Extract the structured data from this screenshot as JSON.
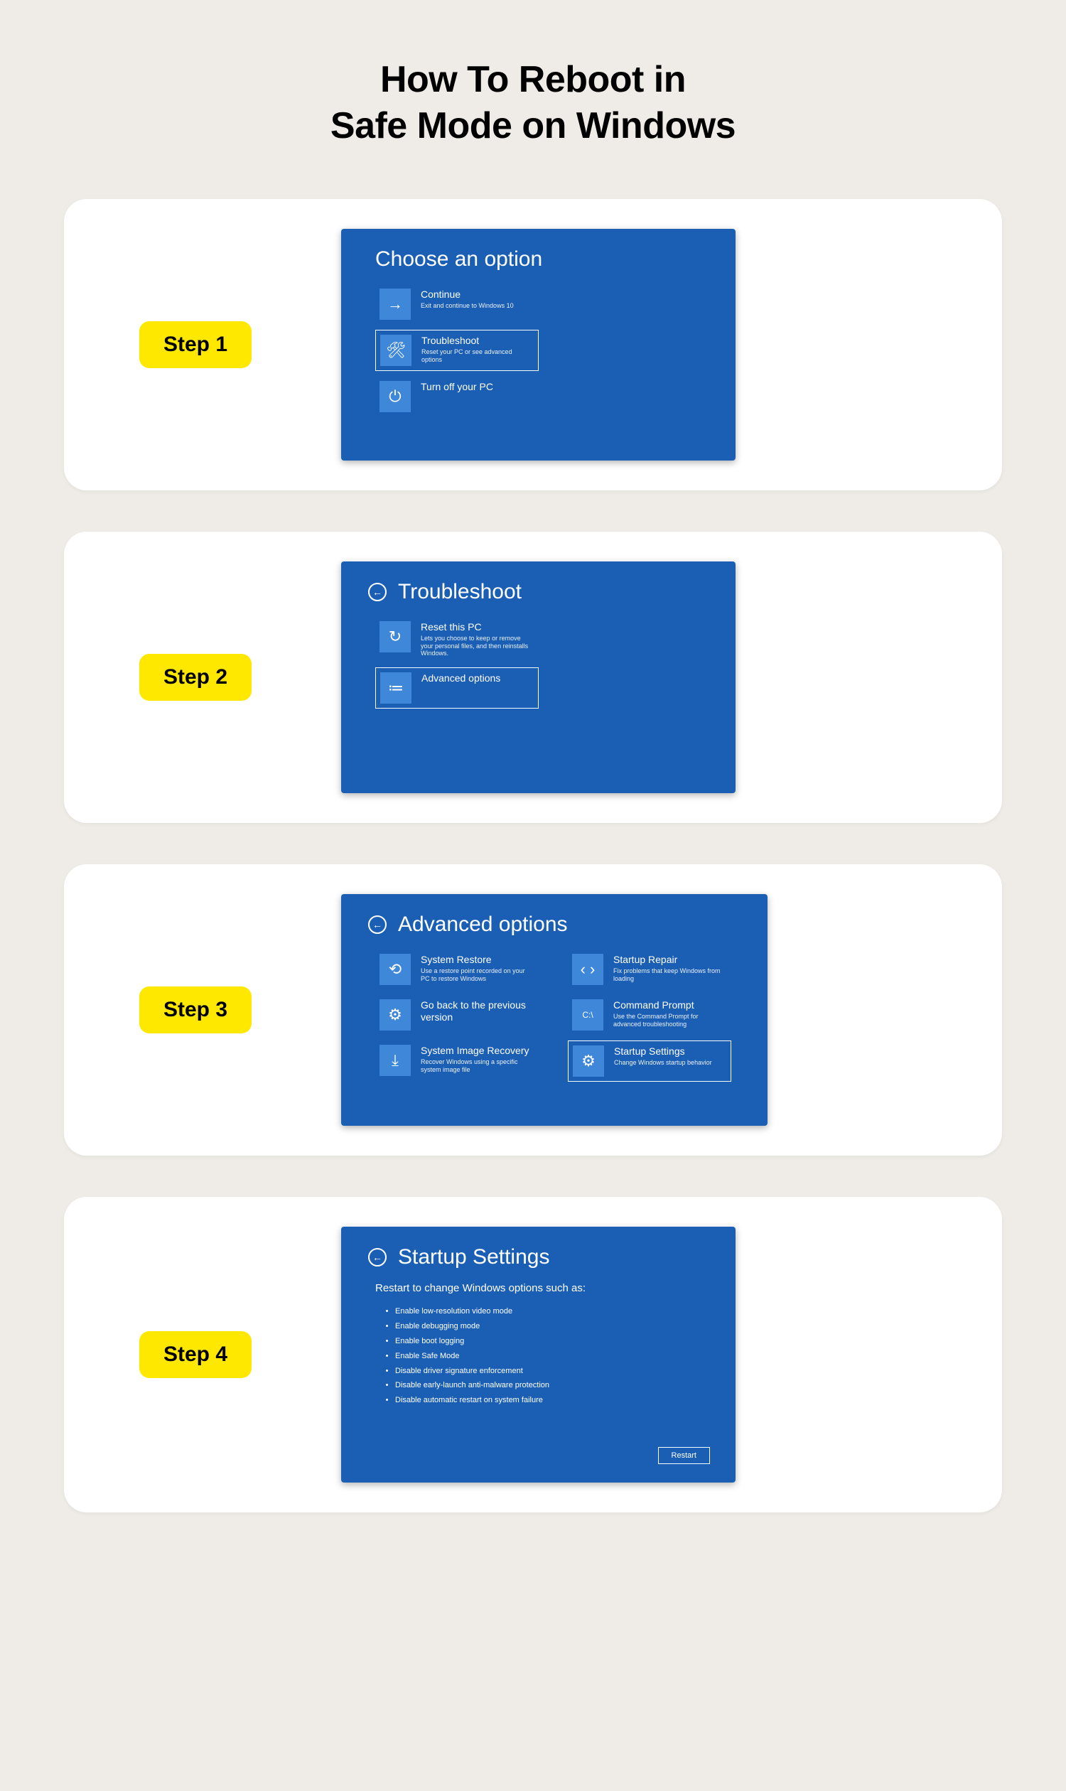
{
  "title_line1": "How To Reboot in",
  "title_line2": "Safe Mode on Windows",
  "steps": {
    "s1": {
      "badge": "Step 1",
      "header": "Choose an option",
      "opt_continue": {
        "title": "Continue",
        "sub": "Exit and continue to Windows 10"
      },
      "opt_troubleshoot": {
        "title": "Troubleshoot",
        "sub": "Reset your PC or see advanced options"
      },
      "opt_turnoff": {
        "title": "Turn off your PC",
        "sub": ""
      }
    },
    "s2": {
      "badge": "Step 2",
      "header": "Troubleshoot",
      "opt_reset": {
        "title": "Reset this PC",
        "sub": "Lets you choose to keep or remove your personal files, and then reinstalls Windows."
      },
      "opt_advanced": {
        "title": "Advanced options",
        "sub": ""
      }
    },
    "s3": {
      "badge": "Step 3",
      "header": "Advanced options",
      "opt_restore": {
        "title": "System Restore",
        "sub": "Use a restore point recorded on your PC to restore Windows"
      },
      "opt_goback": {
        "title": "Go back to the previous version",
        "sub": ""
      },
      "opt_image": {
        "title": "System Image Recovery",
        "sub": "Recover Windows using a specific system image file"
      },
      "opt_repair": {
        "title": "Startup Repair",
        "sub": "Fix problems that keep Windows from loading"
      },
      "opt_cmd": {
        "title": "Command Prompt",
        "sub": "Use the Command Prompt for advanced troubleshooting"
      },
      "opt_startup": {
        "title": "Startup Settings",
        "sub": "Change Windows startup behavior"
      }
    },
    "s4": {
      "badge": "Step 4",
      "header": "Startup Settings",
      "subhead": "Restart to change Windows options such as:",
      "bullets": {
        "b0": "Enable low-resolution video mode",
        "b1": "Enable debugging mode",
        "b2": "Enable boot logging",
        "b3": "Enable Safe Mode",
        "b4": "Disable driver signature enforcement",
        "b5": "Disable early-launch anti-malware protection",
        "b6": "Disable automatic restart on system failure"
      },
      "restart_label": "Restart"
    }
  },
  "icons": {
    "arrow_right": "→",
    "tools": "🛠",
    "power": "⏻",
    "refresh": "↻",
    "list": "≔",
    "restore": "⟲",
    "gear": "⚙",
    "image": "⤓",
    "code": "‹ ›",
    "prompt": "C:\\",
    "back": "←"
  }
}
